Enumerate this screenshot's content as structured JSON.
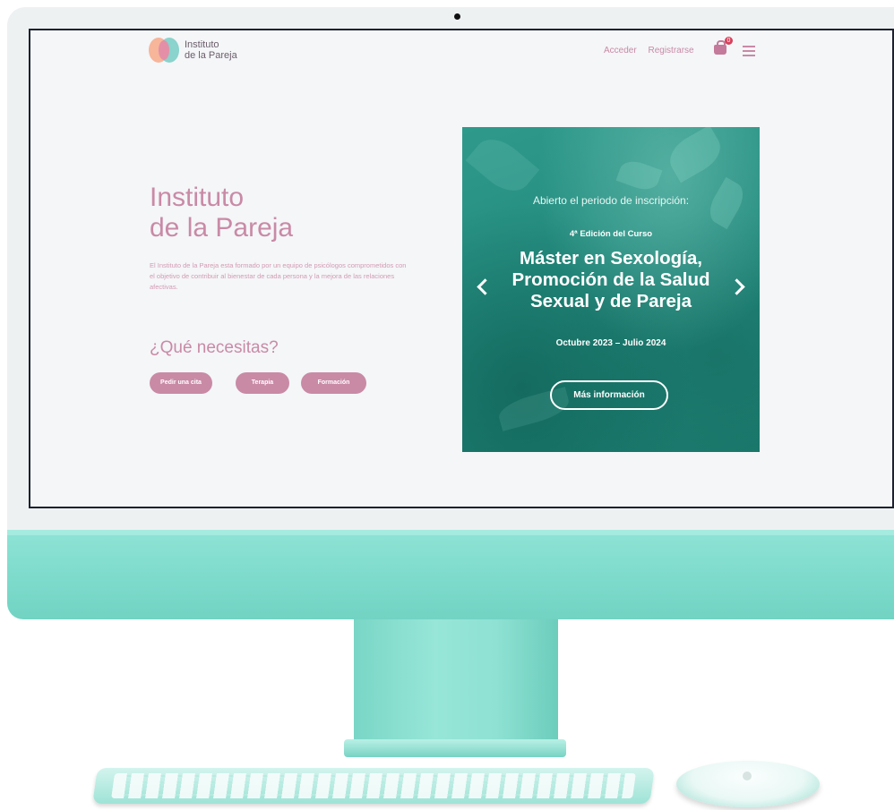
{
  "site": {
    "logo": {
      "line1": "Instituto",
      "line2": "de la Pareja"
    },
    "nav": {
      "login": "Acceder",
      "register": "Registrarse"
    },
    "cart_count": "0"
  },
  "hero": {
    "title_line1": "Instituto",
    "title_line2": "de la Pareja",
    "description": "El Instituto de la Pareja esta formado por un equipo de psicólogos comprometidos con el objetivo de contribuir al bienestar de cada persona y la mejora de las relaciones afectivas.",
    "needs_title": "¿Qué necesitas?",
    "buttons": [
      "Pedir una cita",
      "Terapia",
      "Formación"
    ]
  },
  "promo": {
    "subtitle": "Abierto el periodo de inscripción:",
    "edition": "4ª Edición del Curso",
    "title_line1": "Máster en Sexología,",
    "title_line2": "Promoción de la Salud",
    "title_line3": "Sexual y de Pareja",
    "dates": "Octubre 2023 – Julio 2024",
    "cta": "Más información"
  },
  "colors": {
    "brand_pink": "#c98aa6",
    "promo_teal": "#228a7d",
    "imac_teal": "#7ddbcc"
  },
  "icons": {
    "cart": "shopping-bag-icon",
    "menu": "hamburger-menu-icon",
    "prev": "chevron-left-icon",
    "next": "chevron-right-icon"
  }
}
